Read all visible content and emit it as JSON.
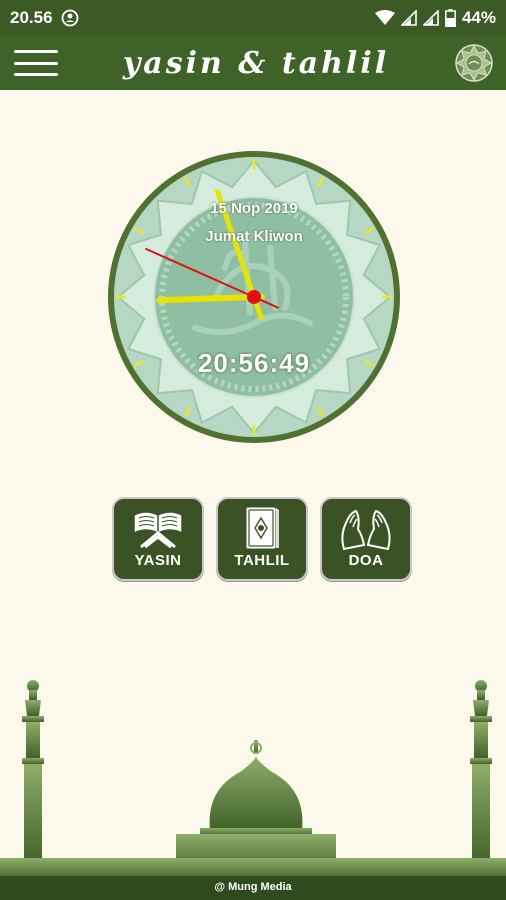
{
  "status_bar": {
    "time": "20.56",
    "battery": "44%"
  },
  "app_bar": {
    "title": "yasin & tahlil"
  },
  "clock": {
    "date": "15 Nop 2019",
    "day": "Jumat Kliwon",
    "time": "20:56:49",
    "hour": 20,
    "minute": 56,
    "second": 49
  },
  "menu": {
    "items": [
      {
        "label": "YASIN",
        "icon": "open-quran-icon"
      },
      {
        "label": "TAHLIL",
        "icon": "quran-book-icon"
      },
      {
        "label": "DOA",
        "icon": "praying-hands-icon"
      }
    ]
  },
  "footer": {
    "credit": "@ Mung Media"
  },
  "colors": {
    "bar": "#3f6229",
    "status": "#3c5a25",
    "background": "#fcf9ec",
    "tile": "#3b5324",
    "clock_rim": "#4f7230",
    "clock_face": "#a8cdb5",
    "tick": "#e8e82a",
    "second_hand": "#e01010"
  }
}
